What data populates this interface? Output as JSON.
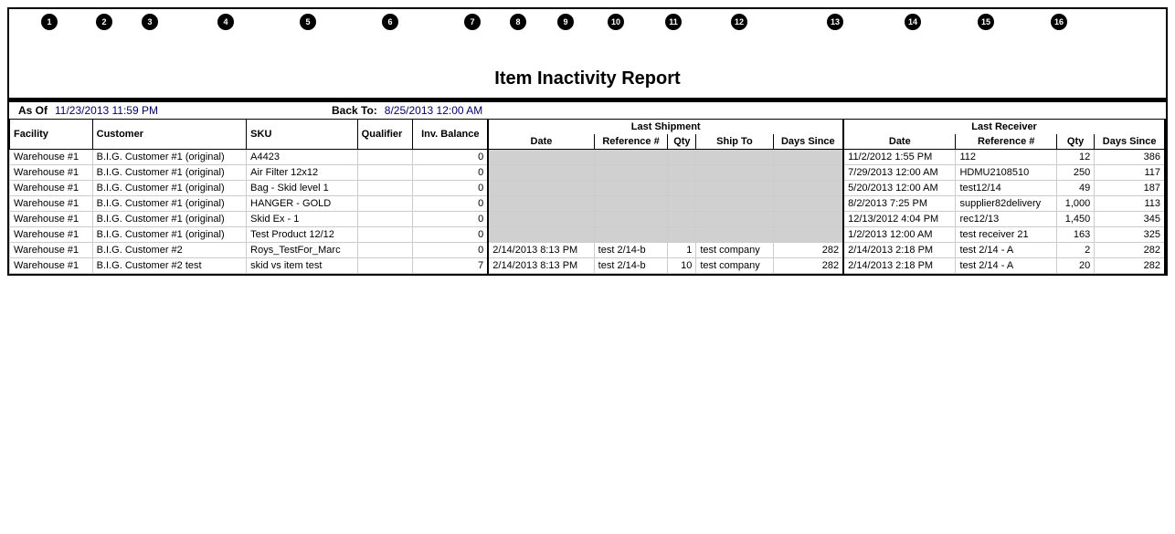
{
  "report": {
    "title": "Item Inactivity Report",
    "asof_label": "As Of",
    "asof_value": "11/23/2013 11:59 PM",
    "backto_label": "Back To:",
    "backto_value": "8/25/2013 12:00 AM"
  },
  "columns": {
    "facility": "Facility",
    "customer": "Customer",
    "sku": "SKU",
    "qualifier": "Qualifier",
    "inv_balance": "Inv. Balance",
    "last_shipment": "Last Shipment",
    "last_receiver": "Last Receiver",
    "date": "Date",
    "reference": "Reference #",
    "qty": "Qty",
    "ship_to": "Ship To",
    "days_since": "Days Since"
  },
  "numbers": [
    "1",
    "2",
    "3",
    "4",
    "5",
    "6",
    "7",
    "8",
    "9",
    "10",
    "11",
    "12",
    "13",
    "14",
    "15",
    "16"
  ],
  "rows": [
    {
      "facility": "Warehouse #1",
      "customer": "B.I.G. Customer #1 (original)",
      "sku": "A4423",
      "qualifier": "",
      "inv_balance": "0",
      "ls_date": "",
      "ls_ref": "",
      "ls_qty": "",
      "ls_shipto": "",
      "ls_days": "",
      "lr_date": "11/2/2012 1:55 PM",
      "lr_ref": "112",
      "lr_qty": "12",
      "lr_days": "386"
    },
    {
      "facility": "Warehouse #1",
      "customer": "B.I.G. Customer #1 (original)",
      "sku": "Air Filter 12x12",
      "qualifier": "",
      "inv_balance": "0",
      "ls_date": "",
      "ls_ref": "",
      "ls_qty": "",
      "ls_shipto": "",
      "ls_days": "",
      "lr_date": "7/29/2013 12:00 AM",
      "lr_ref": "HDMU2108510",
      "lr_qty": "250",
      "lr_days": "117"
    },
    {
      "facility": "Warehouse #1",
      "customer": "B.I.G. Customer #1 (original)",
      "sku": "Bag - Skid level 1",
      "qualifier": "",
      "inv_balance": "0",
      "ls_date": "",
      "ls_ref": "",
      "ls_qty": "",
      "ls_shipto": "",
      "ls_days": "",
      "lr_date": "5/20/2013 12:00 AM",
      "lr_ref": "test12/14",
      "lr_qty": "49",
      "lr_days": "187"
    },
    {
      "facility": "Warehouse #1",
      "customer": "B.I.G. Customer #1 (original)",
      "sku": "HANGER - GOLD",
      "qualifier": "",
      "inv_balance": "0",
      "ls_date": "",
      "ls_ref": "",
      "ls_qty": "",
      "ls_shipto": "",
      "ls_days": "",
      "lr_date": "8/2/2013 7:25 PM",
      "lr_ref": "supplier82delivery",
      "lr_qty": "1,000",
      "lr_days": "113"
    },
    {
      "facility": "Warehouse #1",
      "customer": "B.I.G. Customer #1 (original)",
      "sku": "Skid Ex - 1",
      "qualifier": "",
      "inv_balance": "0",
      "ls_date": "",
      "ls_ref": "",
      "ls_qty": "",
      "ls_shipto": "",
      "ls_days": "",
      "lr_date": "12/13/2012 4:04 PM",
      "lr_ref": "rec12/13",
      "lr_qty": "1,450",
      "lr_days": "345"
    },
    {
      "facility": "Warehouse #1",
      "customer": "B.I.G. Customer #1 (original)",
      "sku": "Test Product 12/12",
      "qualifier": "",
      "inv_balance": "0",
      "ls_date": "",
      "ls_ref": "",
      "ls_qty": "",
      "ls_shipto": "",
      "ls_days": "",
      "lr_date": "1/2/2013 12:00 AM",
      "lr_ref": "test receiver 21",
      "lr_qty": "163",
      "lr_days": "325"
    },
    {
      "facility": "Warehouse #1",
      "customer": "B.I.G. Customer #2",
      "sku": "Roys_TestFor_Marc",
      "qualifier": "",
      "inv_balance": "0",
      "ls_date": "2/14/2013 8:13 PM",
      "ls_ref": "test 2/14-b",
      "ls_qty": "1",
      "ls_shipto": "test company",
      "ls_days": "282",
      "lr_date": "2/14/2013 2:18 PM",
      "lr_ref": "test 2/14 - A",
      "lr_qty": "2",
      "lr_days": "282"
    },
    {
      "facility": "Warehouse #1",
      "customer": "B.I.G. Customer #2 test",
      "sku": "skid vs item test",
      "qualifier": "",
      "inv_balance": "7",
      "ls_date": "2/14/2013 8:13 PM",
      "ls_ref": "test 2/14-b",
      "ls_qty": "10",
      "ls_shipto": "test company",
      "ls_days": "282",
      "lr_date": "2/14/2013 2:18 PM",
      "lr_ref": "test 2/14 - A",
      "lr_qty": "20",
      "lr_days": "282"
    }
  ]
}
